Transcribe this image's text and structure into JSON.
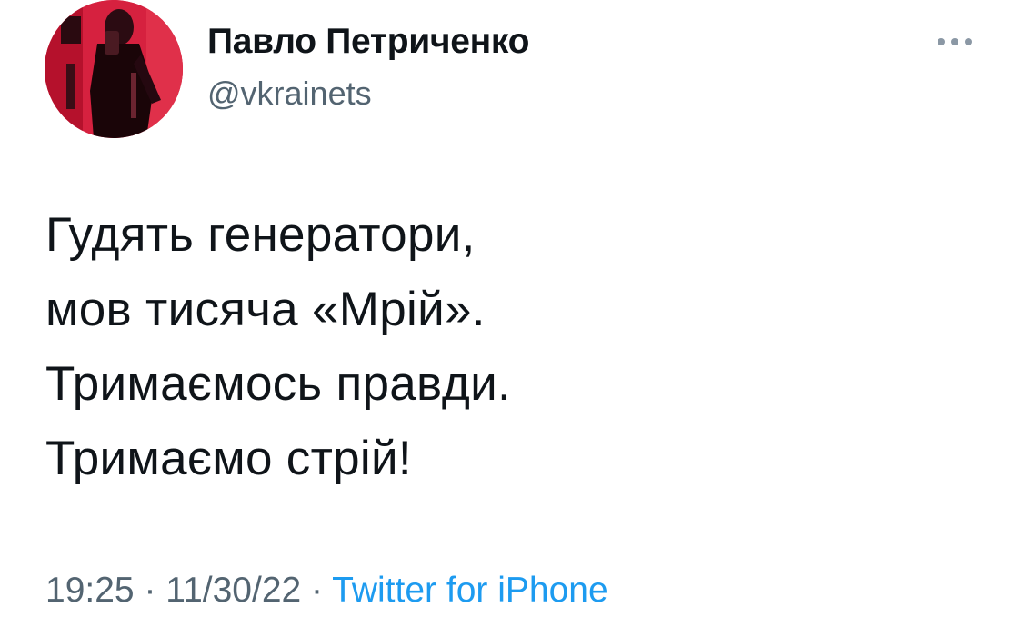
{
  "author": {
    "display_name": "Павло Петриченко",
    "handle": "@vkrainets",
    "avatar_icon": "profile-photo-avatar",
    "avatar_tint": "#d11a3a"
  },
  "more_icon": "ellipsis-icon",
  "tweet": {
    "lines": [
      "Гудять генератори,",
      "мов тисяча «Мрій».",
      "Тримаємось правди.",
      "Тримаємо стрій!"
    ]
  },
  "meta": {
    "time": "19:25",
    "separator": " · ",
    "date": "11/30/22",
    "source": "Twitter for iPhone"
  },
  "colors": {
    "text": "#0f1419",
    "secondary": "#536471",
    "link": "#1d9bf0"
  }
}
